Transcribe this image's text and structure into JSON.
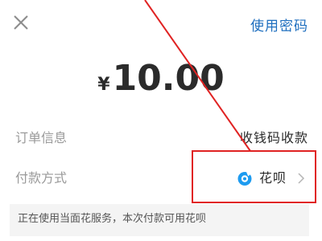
{
  "header": {
    "close_icon": "close-icon",
    "use_password_label": "使用密码"
  },
  "amount": {
    "currency": "¥",
    "value": "10.00"
  },
  "order_info": {
    "label": "订单信息",
    "value": "收钱码收款"
  },
  "payment_method": {
    "label": "付款方式",
    "method": "花呗",
    "icon": "huabei-icon",
    "chevron_icon": "chevron-right-icon"
  },
  "notice": {
    "text": "正在使用当面花服务，本次付款可用花呗"
  },
  "colors": {
    "accent_blue": "#1f6fbf",
    "annotation_red": "#e02323",
    "huabei_blue": "#1d9bf0"
  }
}
